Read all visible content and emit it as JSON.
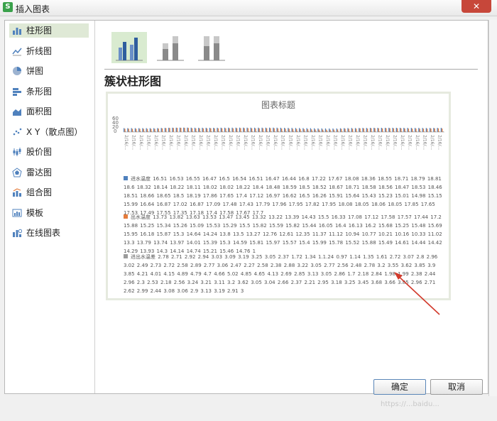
{
  "window": {
    "title": "插入图表",
    "app_icon": "S",
    "close_glyph": "✕"
  },
  "sidebar": {
    "items": [
      {
        "label": "柱形图",
        "icon": "column-chart-icon",
        "active": true
      },
      {
        "label": "折线图",
        "icon": "line-chart-icon"
      },
      {
        "label": "饼图",
        "icon": "pie-chart-icon"
      },
      {
        "label": "条形图",
        "icon": "bar-chart-icon"
      },
      {
        "label": "面积图",
        "icon": "area-chart-icon"
      },
      {
        "label": "X Y（散点图）",
        "icon": "scatter-chart-icon"
      },
      {
        "label": "股价图",
        "icon": "stock-chart-icon"
      },
      {
        "label": "雷达图",
        "icon": "radar-chart-icon"
      },
      {
        "label": "组合图",
        "icon": "combo-chart-icon"
      },
      {
        "label": "模板",
        "icon": "template-icon"
      },
      {
        "label": "在线图表",
        "icon": "online-chart-icon"
      }
    ]
  },
  "subtypes": [
    {
      "name": "clustered-column",
      "selected": true
    },
    {
      "name": "stacked-column"
    },
    {
      "name": "percent-stacked-column"
    }
  ],
  "section_title": "簇状柱形图",
  "preview": {
    "chart_title": "图表标题",
    "y_ticks": [
      "60",
      "40",
      "20",
      "0"
    ],
    "x_tick_label": "2/16/...",
    "series": [
      {
        "color": "#4f81bd",
        "label": "进水温度 16.51 16.53 16.55 16.47 16.5 16.54 16.51 16.47 16.44 16.8 17.22 17.67 18.08 18.36 18.55 18.71 18.79 18.81 18.6 18.32 18.14 18.22 18.11 18.02 18.02 18.22 18.4 18.48 18.59 18.5 18.52 18.67 18.71 18.58 18.56 18.47 18.53 18.46 18.51 18.66 18.65 18.5 18.19 17.86 17.65 17.4 17.12 16.97 16.62 16.5 16.26 15.91 15.64 15.43 15.23 15.01 14.98 15.15 15.99 16.64 16.87 17.02 16.87 17.09 17.48 17.43 17.79 17.96 17.95 17.82 17.95 18.08 18.05 18.06 18.05 17.85 17.65 17.53 17.49 17.55 17.35 17.18 17.4 17.58 17.67 17.7"
      },
      {
        "color": "#e47c3c",
        "label": "出水温度 13.73 13.82 13.63 13.53 13.47 13.45 13.32 13.22 13.39 14.43 15.5 16.33 17.08 17.12 17.58 17.57 17.44 17.2 15.88 15.25 15.34 15.26 15.09 15.53 15.29 15.5 15.82 15.59 15.82 15.44 16.05 16.4 16.13 16.2 15.68 15.25 15.48 15.69 15.95 16.18 15.87 15.3 14.64 14.24 13.8 13.5 13.27 12.76 12.61 12.35 11.37 11.12 10.94 10.77 10.21 10.16 10.33 11.02 13.3 13.79 13.74 13.97 14.01 15.39 15.3 14.59 15.81 15.97 15.57 15.4 15.99 15.78 15.52 15.88 15.49 14.61 14.44 14.42 14.29 13.93 14.3 14.14 14.74 15.21 15.46 14.76 1"
      },
      {
        "color": "#9b9b9b",
        "label": "进出水温差 2.78 2.71 2.92 2.94 3.03 3.09 3.19 3.25 3.05 2.37 1.72 1.34 1.1.24 0.97 1.14 1.35 1.61 2.72 3.07 2.8 2.96 3.02 2.49 2.73 2.72 2.58 2.89 2.77 3.06 2.47 2.27 2.58 2.38 2.88 3.22 3.05 2.77 2.56 2.48 2.78 3.2 3.55 3.62 3.85 3.9 3.85 4.21 4.01 4.15 4.89 4.79 4.7 4.66 5.02 4.85 4.65 4.13 2.69 2.85 3.13 3.05 2.86 1.7 2.18 2.84 1.98 1.99 2.38 2.44 2.96 2.3 2.53 2.18 2.56 3.24 3.21 3.11 3.2 3.62 3.05 3.04 2.66 2.37 2.21 2.95 3.18 3.25 3.45 3.68 3.66 3.85 2.96 2.71 2.62 2.99 2.44 3.08 3.06 2.9 3.13 3.19 2.91 3"
      }
    ]
  },
  "buttons": {
    "ok_label": "确定",
    "cancel_label": "取消"
  },
  "watermark": "https://...baidu..."
}
